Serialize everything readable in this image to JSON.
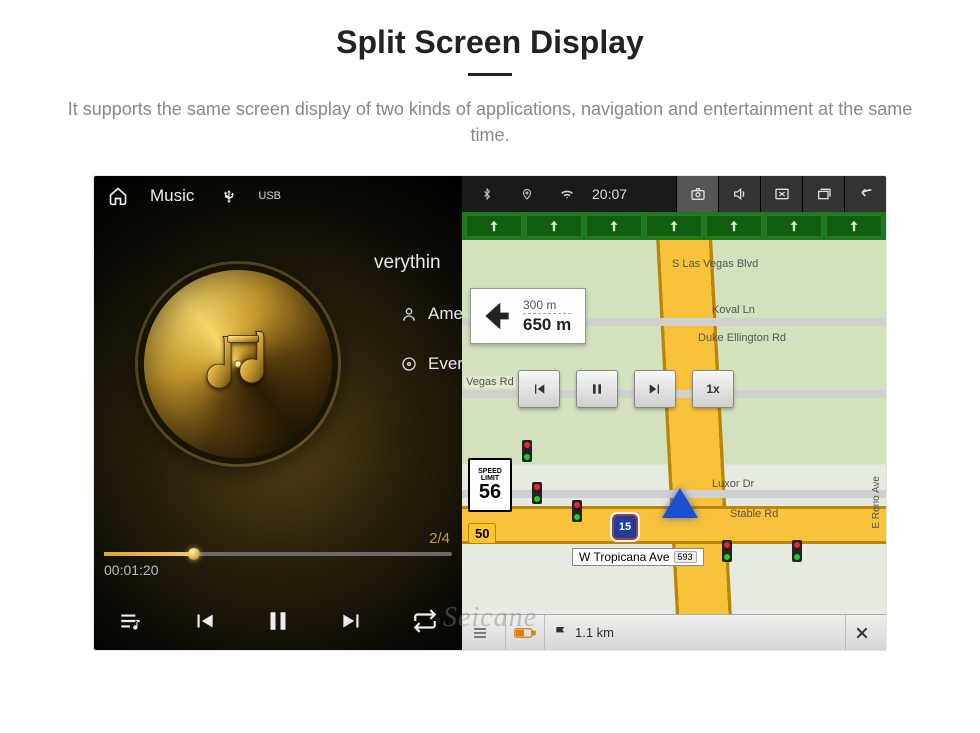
{
  "page": {
    "title": "Split Screen Display",
    "subtitle": "It supports the same screen display of two kinds of applications, navigation and entertainment at the same time."
  },
  "watermark": "Seicane",
  "music": {
    "app_label": "Music",
    "source": "USB",
    "song": "verythin",
    "artist": "Ame",
    "album": "Ever",
    "elapsed": "00:01:20",
    "track_index": "2/4"
  },
  "statusbar": {
    "time": "20:07"
  },
  "nav": {
    "turn": {
      "next": "300 m",
      "total": "650 m"
    },
    "speed_limit": {
      "label1": "SPEED",
      "label2": "LIMIT",
      "value": "56"
    },
    "badge": "50",
    "interstate": "15",
    "streets": {
      "vegas": "S Las Vegas Blvd",
      "koval": "Koval Ln",
      "duke": "Duke Ellington Rd",
      "vegasrd": "Vegas Rd",
      "luxor": "Luxor Dr",
      "stable": "Stable Rd",
      "reno": "E Reno Ave"
    },
    "tropicana": {
      "name": "W Tropicana Ave",
      "num": "593"
    },
    "sim": {
      "speed": "1x"
    },
    "footer": {
      "dist_km": "1.1 km"
    }
  }
}
